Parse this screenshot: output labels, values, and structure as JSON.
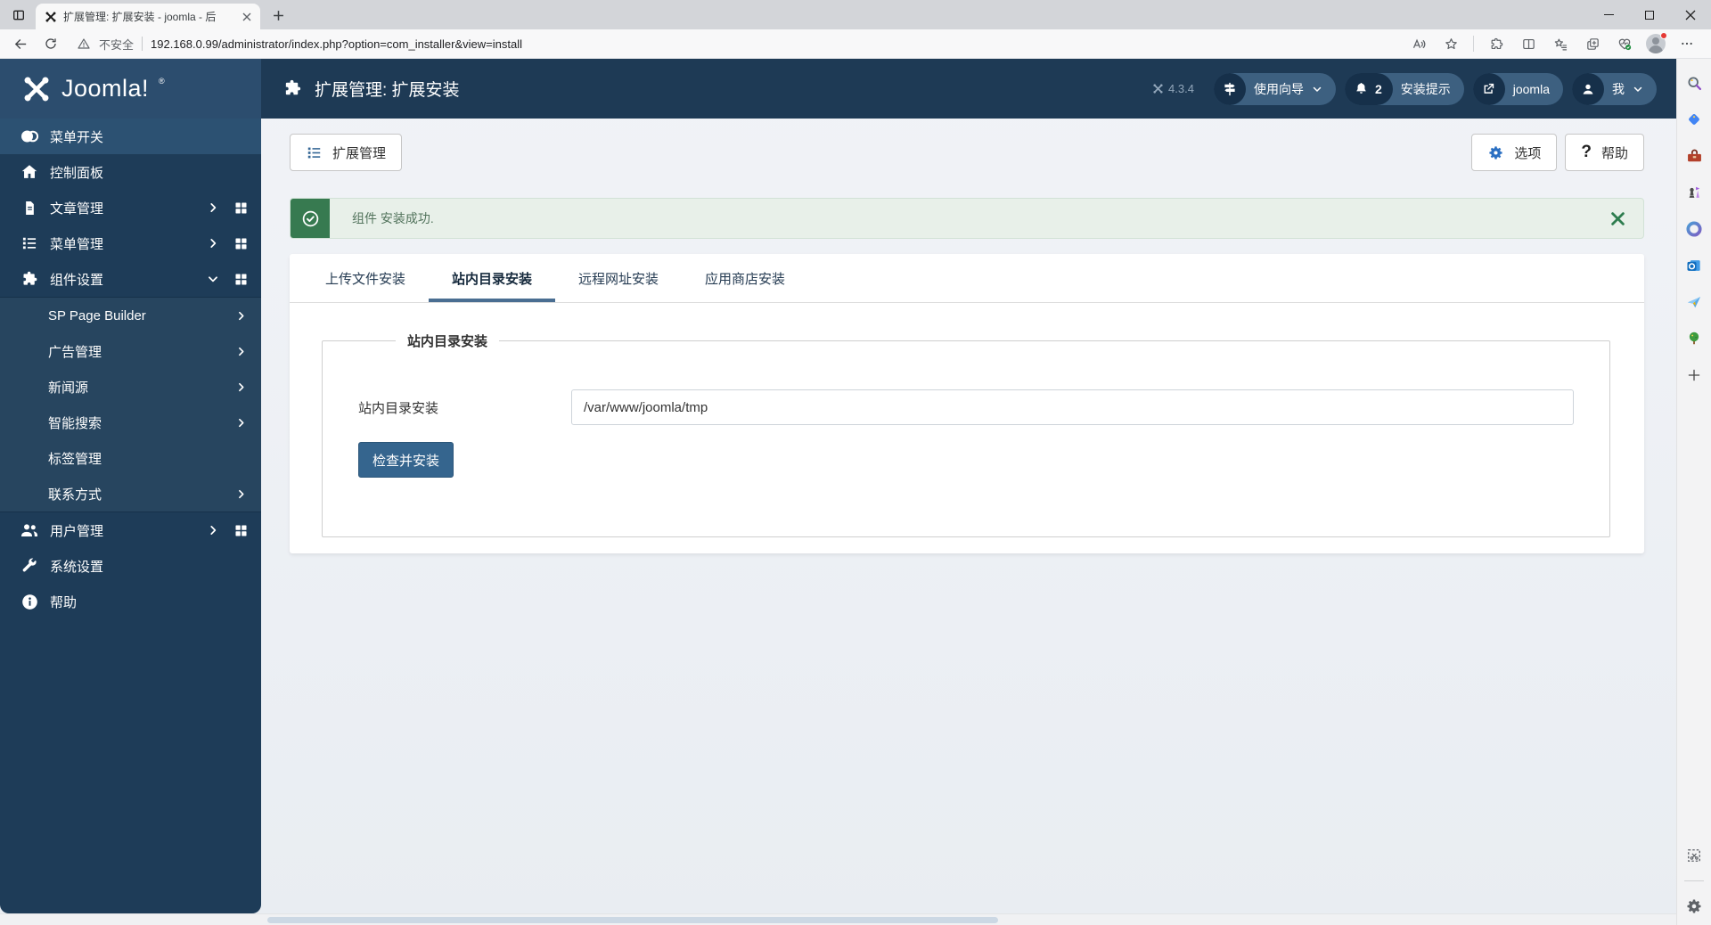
{
  "browser": {
    "tab_title": "扩展管理: 扩展安装 - joomla - 后",
    "security_label": "不安全",
    "url": "192.168.0.99/administrator/index.php?option=com_installer&view=install"
  },
  "joomla_header": {
    "logo": "Joomla!",
    "logo_reg": "®",
    "page_title": "扩展管理: 扩展安装",
    "version": "4.3.4",
    "guide_label": "使用向导",
    "notice_count": "2",
    "notice_label": "安装提示",
    "preview_label": "joomla",
    "user_label": "我"
  },
  "sidebar": {
    "items": [
      {
        "label": "菜单开关"
      },
      {
        "label": "控制面板"
      },
      {
        "label": "文章管理"
      },
      {
        "label": "菜单管理"
      },
      {
        "label": "组件设置"
      },
      {
        "label": "用户管理"
      },
      {
        "label": "系统设置"
      },
      {
        "label": "帮助"
      }
    ],
    "submenu": [
      {
        "label": "SP Page Builder"
      },
      {
        "label": "广告管理"
      },
      {
        "label": "新闻源"
      },
      {
        "label": "智能搜索"
      },
      {
        "label": "标签管理"
      },
      {
        "label": "联系方式"
      }
    ]
  },
  "toolbar": {
    "extensions_label": "扩展管理",
    "options_label": "选项",
    "help_label": "帮助",
    "help_icon": "?"
  },
  "alert": {
    "message": "组件 安装成功."
  },
  "tabs": {
    "items": [
      {
        "label": "上传文件安装"
      },
      {
        "label": "站内目录安装"
      },
      {
        "label": "远程网址安装"
      },
      {
        "label": "应用商店安装"
      }
    ]
  },
  "form": {
    "legend": "站内目录安装",
    "label": "站内目录安装",
    "value": "/var/www/joomla/tmp",
    "button": "检查并安装"
  },
  "edge_rail": {
    "icons": [
      "search",
      "shopping",
      "toolbox",
      "games",
      "microsoft-365",
      "outlook",
      "drop",
      "tree",
      "add"
    ],
    "bottom_icons": [
      "web-capture",
      "settings"
    ]
  },
  "colors": {
    "header_navy": "#1e3a55",
    "sidebar_navy": "#1e3c58",
    "accent_blue": "#35658e",
    "success_green": "#377a50"
  }
}
